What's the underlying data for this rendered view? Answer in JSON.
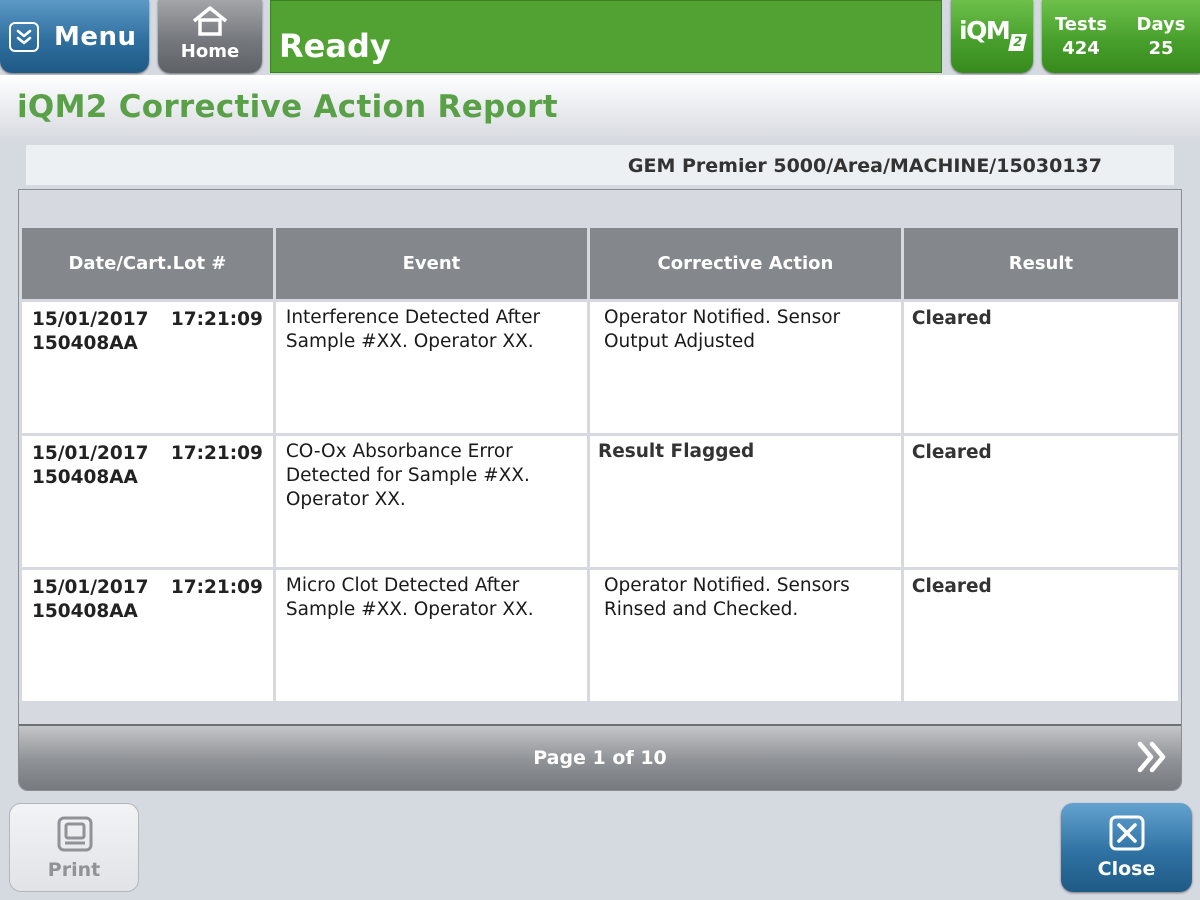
{
  "topbar": {
    "menu_label": "Menu",
    "menu_icon": "chevron-down-icon",
    "home_label": "Home",
    "home_icon": "home-icon",
    "status_text": "Ready",
    "status_color": "#52a133",
    "iqm_logo": "iQM",
    "iqm_logo_sub": "2",
    "tests_label": "Tests",
    "tests_value": "424",
    "days_label": "Days",
    "days_value": "25"
  },
  "page": {
    "title": "iQM2 Corrective Action Report",
    "title_color": "#5aa048",
    "device_path": "GEM Premier 5000/Area/MACHINE/15030137"
  },
  "table": {
    "headers": [
      "Date/Cart.Lot #",
      "Event",
      "Corrective Action",
      "Result"
    ],
    "rows": [
      {
        "date": "15/01/2017",
        "time": "17:21:09",
        "lot": "150408AA",
        "event": "Interference Detected After Sample #XX. Operator XX.",
        "action": "Operator Notified. Sensor Output Adjusted",
        "result": "Cleared"
      },
      {
        "date": "15/01/2017",
        "time": "17:21:09",
        "lot": "150408AA",
        "event": "CO-Ox Absorbance Error Detected for Sample #XX. Operator XX.",
        "action": "Result Flagged",
        "result": "Cleared"
      },
      {
        "date": "15/01/2017",
        "time": "17:21:09",
        "lot": "150408AA",
        "event": "Micro Clot Detected After Sample #XX. Operator XX.",
        "action": "Operator Notified. Sensors Rinsed and Checked.",
        "result": "Cleared"
      }
    ]
  },
  "pager": {
    "text": "Page 1 of 10",
    "next_icon": "double-chevron-right-icon"
  },
  "footer": {
    "print_label": "Print",
    "print_icon": "printer-icon",
    "close_label": "Close",
    "close_icon": "close-icon"
  }
}
